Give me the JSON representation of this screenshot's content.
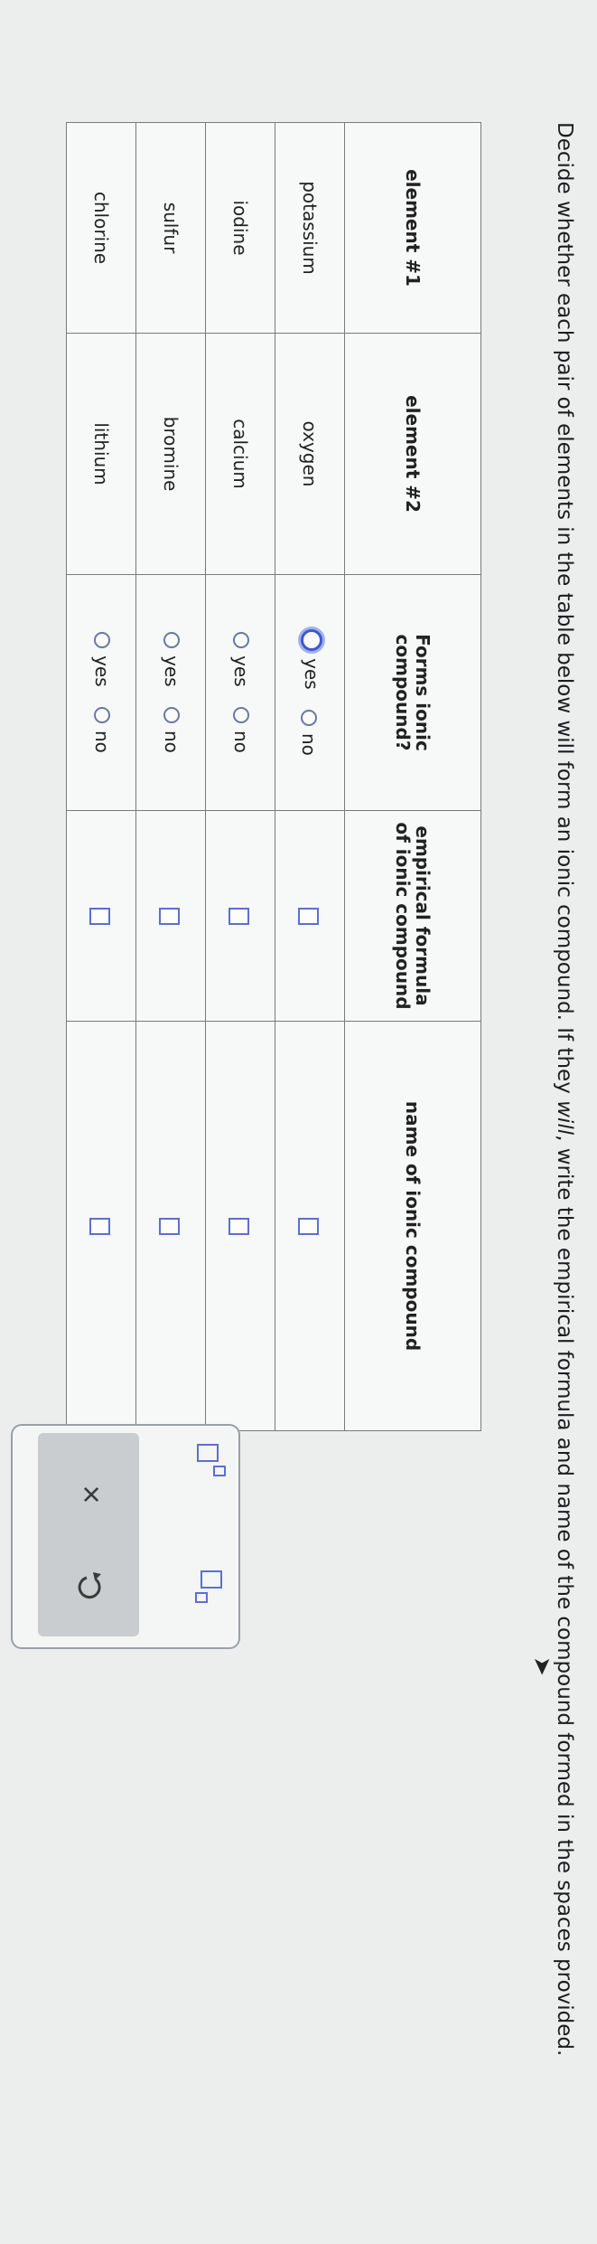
{
  "instructions": {
    "part1": "Decide whether each pair of elements in the table below will form an ionic compound. If they ",
    "will_word": "will",
    "part2": ", write the empirical formula and name of the compound formed in the spaces provided."
  },
  "table": {
    "headers": [
      "element #1",
      "element #2",
      "Forms ionic compound?",
      "empirical formula of ionic compound",
      "name of ionic compound"
    ],
    "rows": [
      {
        "element1": "potassium",
        "element2": "oxygen",
        "selected": "yes"
      },
      {
        "element1": "iodine",
        "element2": "calcium",
        "selected": ""
      },
      {
        "element1": "sulfur",
        "element2": "bromine",
        "selected": ""
      },
      {
        "element1": "chlorine",
        "element2": "lithium",
        "selected": ""
      }
    ],
    "yes_label": "yes",
    "no_label": "no"
  },
  "toolbar": {
    "tools": [
      "superscript-icon",
      "subscript-icon"
    ],
    "actions": [
      "close-icon",
      "undo-icon"
    ],
    "close_glyph": "×"
  },
  "colors": {
    "accent": "#3f59c8",
    "box_border": "#5d6fd0",
    "panel_bar": "#c9cdd0"
  }
}
